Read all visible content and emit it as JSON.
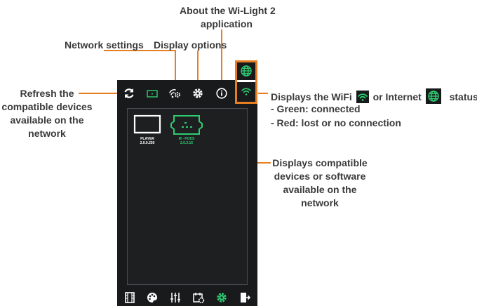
{
  "annotations": {
    "about": [
      "About the Wi-Light 2",
      "application"
    ],
    "network_settings": "Network settings",
    "display_options": "Display options",
    "refresh": [
      "Refresh the",
      "compatible devices",
      "available on the",
      "network"
    ],
    "status_prefix": "Displays the WiFi",
    "status_or": "or Internet",
    "status_suffix": "status",
    "green": "- Green: connected",
    "red": "- Red: lost or no connection",
    "compatible": [
      "Displays compatible",
      "devices or software",
      "available on the",
      "network"
    ]
  },
  "devices": [
    {
      "name": "PLAYER",
      "version": "2.0.0.250",
      "color": "#ffffff"
    },
    {
      "name": "M - PODS",
      "version": "2.0.3.16",
      "color": "#2ecc71"
    }
  ],
  "toolbar_icons": [
    "refresh-icon",
    "display-icon",
    "network-settings-icon",
    "gear-icon",
    "info-icon",
    "globe-icon",
    "wifi-icon"
  ],
  "bottom_icons": [
    "film-icon",
    "palette-icon",
    "sliders-icon",
    "calendar-settings-icon",
    "gear-icon",
    "exit-icon"
  ],
  "colors": {
    "accent": "#e67e22",
    "green": "#2ecc71",
    "dark": "#181a1c"
  }
}
